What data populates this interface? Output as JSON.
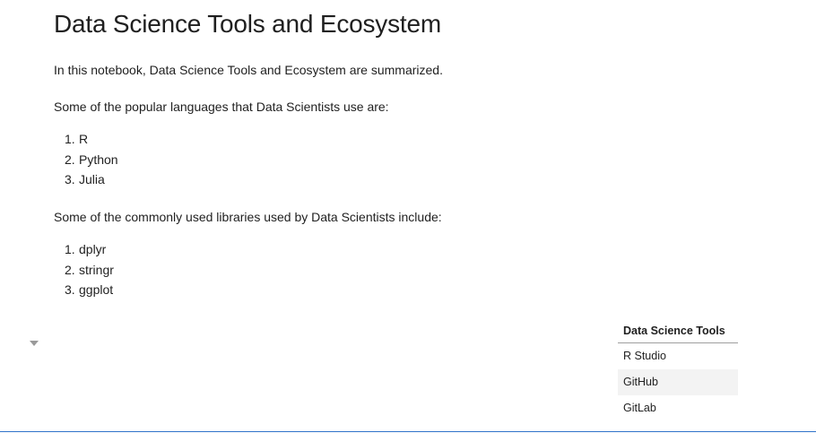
{
  "notebook": {
    "title": "Data Science Tools and Ecosystem",
    "intro": "In this notebook, Data Science Tools and Ecosystem are summarized.",
    "languages_heading": "Some of the popular languages that Data Scientists use are:",
    "languages": [
      {
        "num": "1.",
        "label": "R"
      },
      {
        "num": "2.",
        "label": "Python"
      },
      {
        "num": "3.",
        "label": "Julia"
      }
    ],
    "libraries_heading": "Some of the commonly used libraries used by Data Scientists include:",
    "libraries": [
      {
        "num": "1.",
        "label": "dplyr"
      },
      {
        "num": "2.",
        "label": "stringr"
      },
      {
        "num": "3.",
        "label": "ggplot"
      }
    ],
    "tools_table": {
      "header": "Data Science Tools",
      "rows": [
        "R Studio",
        "GitHub",
        "GitLab"
      ]
    }
  },
  "colors": {
    "text": "#1f1f1f",
    "row_stripe": "#f3f3f3",
    "active_cell_border": "#2f73c9",
    "collapser": "#9a9a9a"
  },
  "icons": {
    "collapser": "caret-down-icon"
  }
}
